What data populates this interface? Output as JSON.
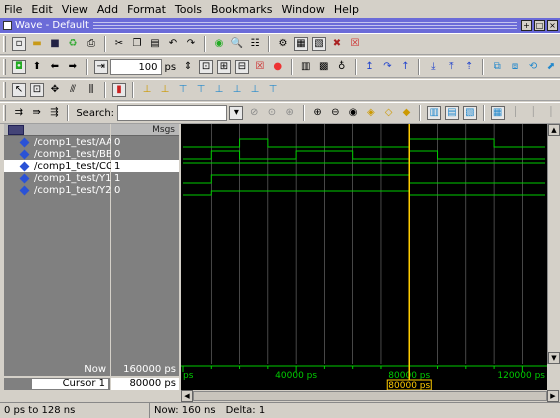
{
  "menu": [
    "File",
    "Edit",
    "View",
    "Add",
    "Format",
    "Tools",
    "Bookmarks",
    "Window",
    "Help"
  ],
  "window": {
    "title": "Wave - Default"
  },
  "toolbar": {
    "time_value": "100",
    "time_unit": "ps",
    "search_label": "Search:",
    "search_value": ""
  },
  "wave": {
    "msgs_header": "Msgs",
    "signals": [
      {
        "name": "/comp1_test/AA",
        "value": "0"
      },
      {
        "name": "/comp1_test/BB",
        "value": "0"
      },
      {
        "name": "/comp1_test/CC",
        "value": "1"
      },
      {
        "name": "/comp1_test/Y1",
        "value": "1"
      },
      {
        "name": "/comp1_test/Y2",
        "value": "0"
      }
    ],
    "now_label": "Now",
    "now_value": "160000 ps",
    "cursor_label": "Cursor 1",
    "cursor_value": "80000 ps",
    "cursor_tag": "80000 ps",
    "timeline_ticks": [
      {
        "time": 0,
        "label": "ps"
      },
      {
        "time": 40000,
        "label": "40000 ps"
      },
      {
        "time": 80000,
        "label": "80000 ps"
      },
      {
        "time": 120000,
        "label": "120000 ps"
      }
    ],
    "time_range": [
      0,
      128000
    ],
    "cursor_time": 80000,
    "signal_color": "#00cc00",
    "cursor_color": "#ffcc00"
  },
  "status": {
    "range": "0 ps to 128 ns",
    "now": "Now: 160 ns",
    "delta": "Delta: 1"
  }
}
